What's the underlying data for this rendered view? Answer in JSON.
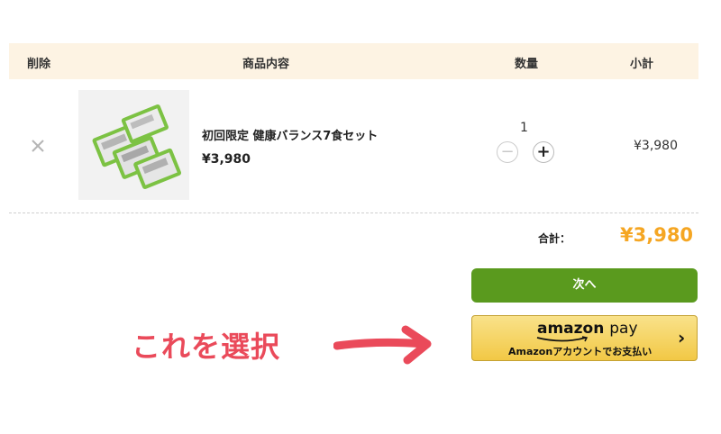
{
  "header": {
    "delete": "削除",
    "product": "商品内容",
    "quantity": "数量",
    "subtotal": "小計"
  },
  "item": {
    "name": "初回限定 健康バランス7食セット",
    "price": "¥3,980",
    "quantity": "1",
    "subtotal": "¥3,980",
    "remove_icon": "close-icon"
  },
  "stepper": {
    "minus": "−",
    "plus": "+"
  },
  "total": {
    "label": "合計：",
    "value": "¥3,980"
  },
  "buttons": {
    "next": "次へ",
    "amazon_logo_word": "amazon",
    "amazon_logo_pay": "pay",
    "amazon_sub": "Amazonアカウントでお支払い",
    "amazon_chevron": "›"
  },
  "annotation": {
    "text": "これを選択"
  },
  "colors": {
    "header_bg": "#fdf3e3",
    "total": "#f5a623",
    "next_button": "#5a9a1e",
    "amazon_button": "#f2c845",
    "annotation": "#ea4a5a"
  }
}
